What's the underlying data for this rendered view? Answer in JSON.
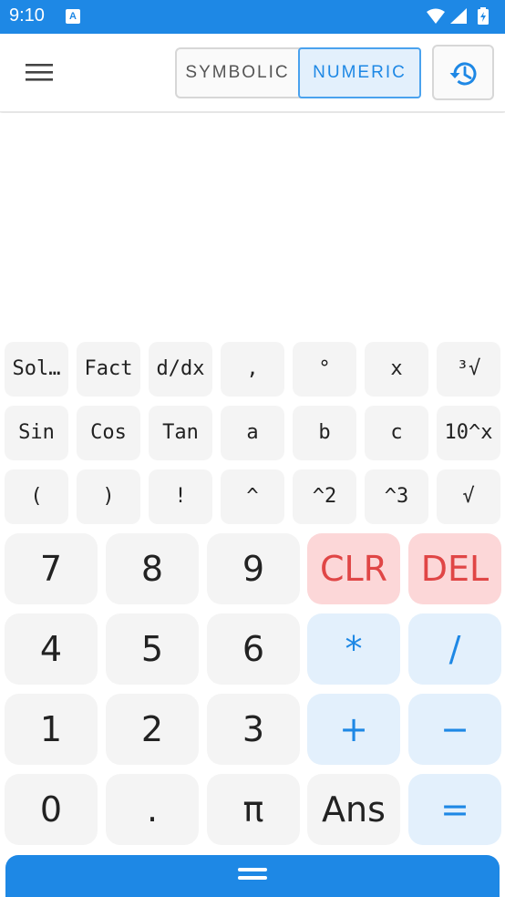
{
  "status_bar": {
    "time": "9:10",
    "notification_icon": "text-a-icon",
    "notification_glyph": "A",
    "system_icons": [
      "wifi-icon",
      "signal-icon",
      "battery-charging-icon"
    ]
  },
  "app_bar": {
    "menu_icon": "hamburger-menu-icon",
    "mode_toggle": {
      "options": [
        "SYMBOLIC",
        "NUMERIC"
      ],
      "selected": "NUMERIC"
    },
    "history_icon": "history-icon"
  },
  "display": {
    "expression": "",
    "result": ""
  },
  "keypad": {
    "function_rows": [
      [
        "Sol…",
        "Fact",
        "d/dx",
        ",",
        "°",
        "x",
        "³√"
      ],
      [
        "Sin",
        "Cos",
        "Tan",
        "a",
        "b",
        "c",
        "10^x"
      ],
      [
        "(",
        ")",
        "!",
        "^",
        "^2",
        "^3",
        "√"
      ]
    ],
    "number_rows": [
      [
        "7",
        "8",
        "9",
        "CLR",
        "DEL"
      ],
      [
        "4",
        "5",
        "6",
        "*",
        "/"
      ],
      [
        "1",
        "2",
        "3",
        "+",
        "−"
      ],
      [
        "0",
        ".",
        "π",
        "Ans",
        "="
      ]
    ]
  },
  "bottom_bar": {
    "icon": "drag-handle-icon"
  },
  "colors": {
    "accent": "#1e88e5",
    "operator_bg": "#e3f0fc",
    "danger_bg": "#fcd7d8",
    "danger_text": "#e04646",
    "key_bg": "#f4f4f4"
  }
}
